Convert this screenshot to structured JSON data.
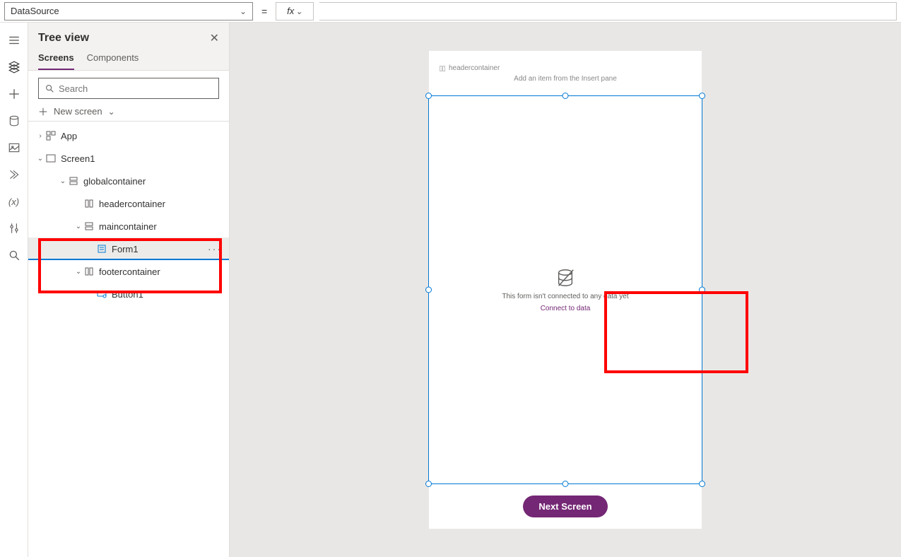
{
  "formulaBar": {
    "property": "DataSource",
    "equals": "=",
    "fx": "fx",
    "formula": ""
  },
  "treeView": {
    "title": "Tree view",
    "tabs": {
      "screens": "Screens",
      "components": "Components"
    },
    "searchPlaceholder": "Search",
    "newScreen": "New screen",
    "nodes": {
      "app": "App",
      "screen1": "Screen1",
      "globalcontainer": "globalcontainer",
      "headercontainer": "headercontainer",
      "maincontainer": "maincontainer",
      "form1": "Form1",
      "footercontainer": "footercontainer",
      "button1": "Button1"
    },
    "more": "···"
  },
  "canvas": {
    "headerLabel": "headercontainer",
    "headerHint": "Add an item from the Insert pane",
    "form": {
      "emptyMsg": "This form isn't connected to any data yet",
      "connectLink": "Connect to data"
    },
    "footer": {
      "button": "Next Screen"
    }
  }
}
